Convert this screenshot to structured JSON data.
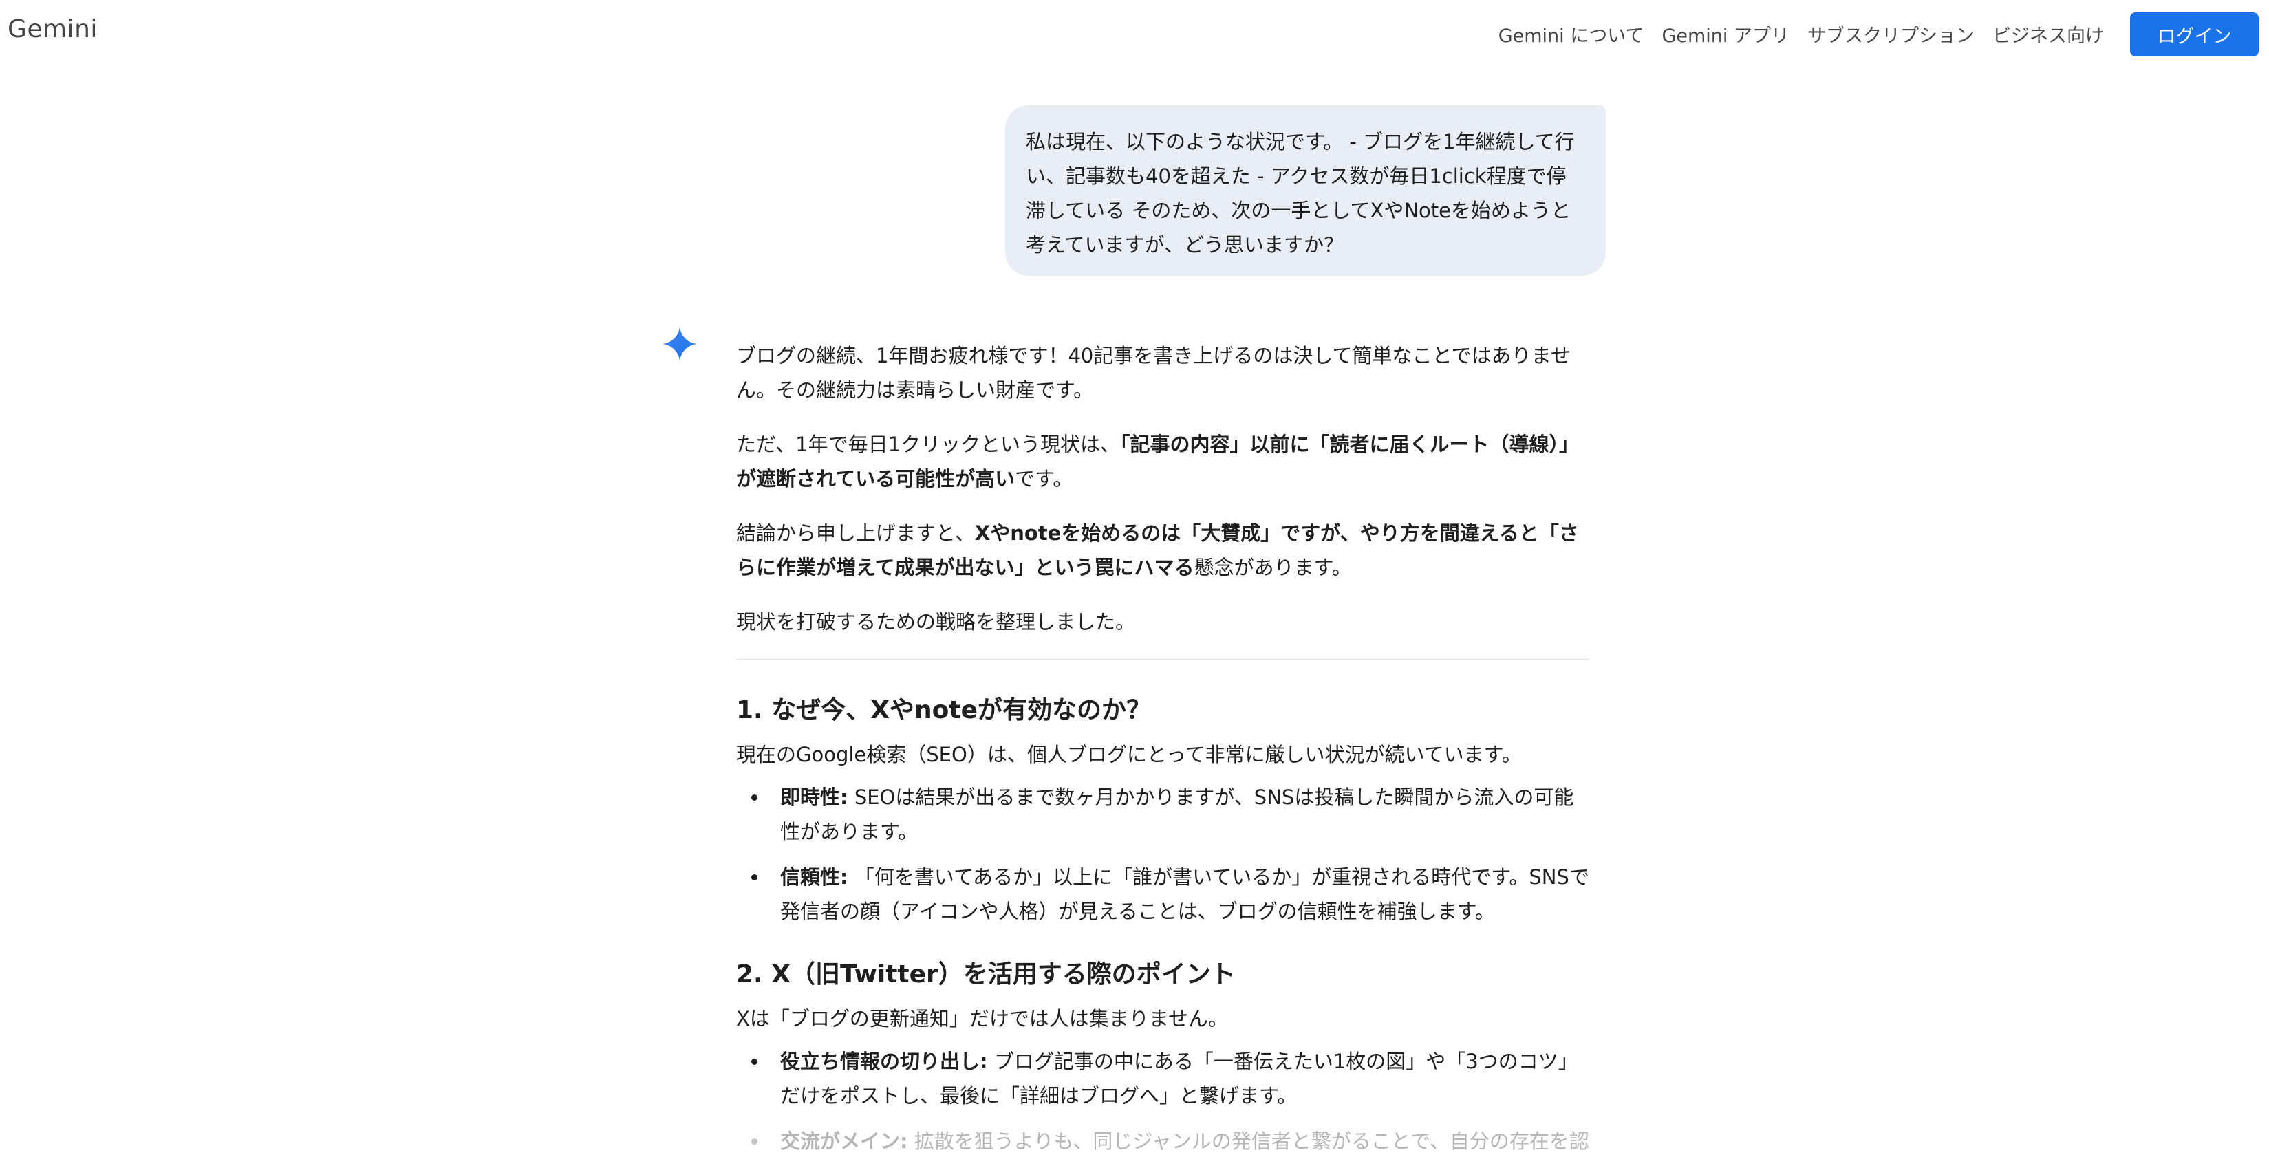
{
  "header": {
    "brand": "Gemini",
    "nav": [
      "Gemini について",
      "Gemini アプリ",
      "サブスクリプション",
      "ビジネス向け"
    ],
    "login_label": "ログイン"
  },
  "conversation": {
    "user_message": "私は現在、以下のような状況です。 - ブログを1年継続して行い、記事数も40を超えた - アクセス数が毎日1click程度で停滞している そのため、次の一手としてXやNoteを始めようと考えていますが、どう思いますか？",
    "response": {
      "p1": "ブログの継続、1年間お疲れ様です！40記事を書き上げるのは決して簡単なことではありません。その継続力は素晴らしい財産です。",
      "p2": {
        "a": "ただ、1年で毎日1クリックという現状は、",
        "b": "「記事の内容」以前に「読者に届くルート（導線）」が遮断されている可能性が高い",
        "c": "です。"
      },
      "p3": {
        "a": "結論から申し上げますと、",
        "b": "Xやnoteを始めるのは「大賛成」ですが、やり方を間違えると「さらに作業が増えて成果が出ない」という罠にハマる",
        "c": "懸念があります。"
      },
      "p4": "現状を打破するための戦略を整理しました。",
      "section1": {
        "heading": "1. なぜ今、Xやnoteが有効なのか？",
        "lead": "現在のGoogle検索（SEO）は、個人ブログにとって非常に厳しい状況が続いています。",
        "items": [
          {
            "label": "即時性:",
            "text": " SEOは結果が出るまで数ヶ月かかりますが、SNSは投稿した瞬間から流入の可能性があります。"
          },
          {
            "label": "信頼性:",
            "text": " 「何を書いてあるか」以上に「誰が書いているか」が重視される時代です。SNSで発信者の顔（アイコンや人格）が見えることは、ブログの信頼性を補強します。"
          }
        ]
      },
      "section2": {
        "heading": "2. X（旧Twitter）を活用する際のポイント",
        "lead": "Xは「ブログの更新通知」だけでは人は集まりません。",
        "items": [
          {
            "label": "役立ち情報の切り出し:",
            "text": " ブログ記事の中にある「一番伝えたい1枚の図」や「3つのコツ」だけをポストし、最後に「詳細はブログへ」と繋げます。"
          },
          {
            "label": "交流がメイン:",
            "text": " 拡散を狙うよりも、同じジャンルの発信者と繋がることで、自分の存在を認"
          }
        ]
      }
    }
  },
  "colors": {
    "accent": "#1a73e8",
    "user_bubble": "#e9eef6",
    "spark_from": "#4285f4",
    "spark_to": "#1a73e8"
  }
}
